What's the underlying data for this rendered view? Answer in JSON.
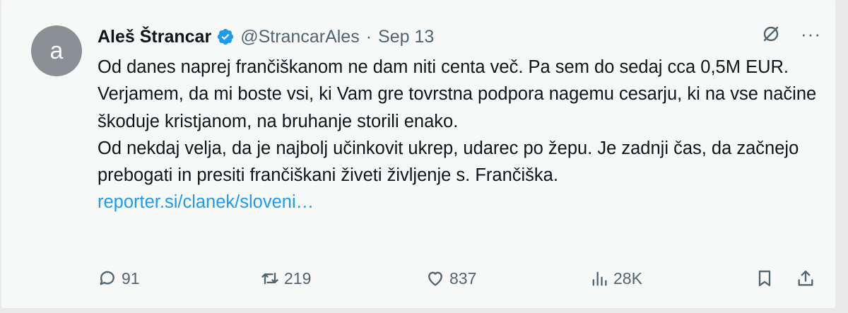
{
  "tweet": {
    "avatar_letter": "a",
    "author_name": "Aleš Štrancar",
    "handle": "@StrancarAles",
    "separator": "·",
    "date": "Sep 13",
    "paragraphs": [
      "Od danes naprej frančiškanom ne dam niti centa več. Pa sem do sedaj cca 0,5M EUR.",
      "Verjamem, da mi boste vsi, ki Vam gre tovrstna podpora nagemu cesarju, ki na vse načine škoduje kristjanom, na bruhanje storili enako.",
      "Od nekdaj velja, da je najbolj učinkovit ukrep, udarec po žepu. Je zadnji čas, da začnejo prebogati in presiti frančiškani živeti življenje s. Frančiška."
    ],
    "link": "reporter.si/clanek/sloveni…",
    "more_label": "···"
  },
  "actions": {
    "replies": "91",
    "reposts": "219",
    "likes": "837",
    "views": "28K"
  },
  "icons": {
    "verified": "verified-badge-icon",
    "grok": "grok-icon",
    "more": "more-icon",
    "reply": "reply-icon",
    "repost": "repost-icon",
    "like": "heart-icon",
    "views": "views-icon",
    "bookmark": "bookmark-icon",
    "share": "share-icon"
  },
  "colors": {
    "text": "#0f1419",
    "secondary": "#536471",
    "link": "#1d9bf0",
    "verified": "#1d9bf0",
    "background": "#f7f9f9"
  }
}
